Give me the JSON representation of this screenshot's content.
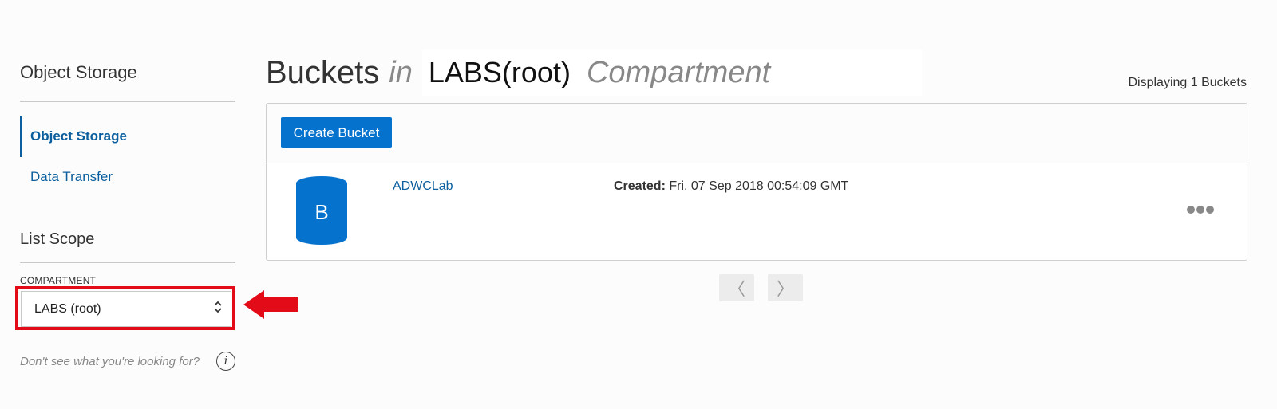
{
  "sidebar": {
    "title": "Object Storage",
    "nav_items": [
      {
        "label": "Object Storage",
        "active": true
      },
      {
        "label": "Data Transfer",
        "active": false
      }
    ],
    "list_scope_title": "List Scope",
    "compartment_label": "COMPARTMENT",
    "compartment_value": "LABS (root)",
    "help_text": "Don't see what you're looking for?",
    "help_icon": "info-icon"
  },
  "header": {
    "title": "Buckets",
    "in_word": "in",
    "compartment_name": "LABS(root)",
    "compartment_word": "Compartment",
    "count_text": "Displaying 1 Buckets"
  },
  "toolbar": {
    "create_label": "Create Bucket"
  },
  "buckets": [
    {
      "icon_letter": "B",
      "name": "ADWCLab",
      "created_label": "Created:",
      "created_value": "Fri, 07 Sep 2018 00:54:09 GMT"
    }
  ],
  "pagination": {
    "prev_icon": "〈",
    "next_icon": "〉"
  },
  "colors": {
    "accent": "#0572ce",
    "link": "#0b5f9e",
    "annotation": "#e30b17"
  }
}
